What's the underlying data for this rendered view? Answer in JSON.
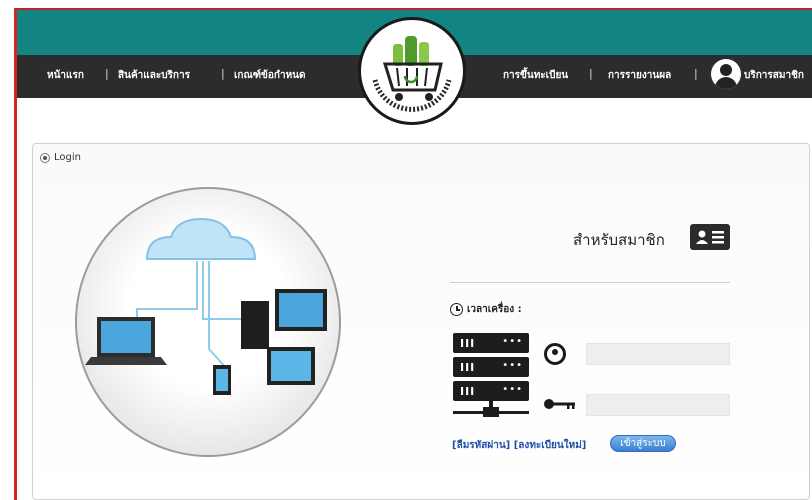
{
  "header": {
    "nav_left": [
      "หน้าแรก",
      "สินค้าและบริการ",
      "เกณฑ์ข้อกำหนด"
    ],
    "nav_right": [
      "การขึ้นทะเบียน",
      "การรายงานผล"
    ],
    "member_service": "บริการสมาชิก",
    "separator": "|",
    "colors": {
      "top_bar": "#128481",
      "nav_bar": "#2c2c2c"
    }
  },
  "logo": {
    "icon": "green-shopping-cart-logo"
  },
  "content": {
    "tab_label": "Login",
    "member_title": "สำหรับสมาชิก",
    "clock_label": "เวลาเครื่อง :",
    "username": {
      "value": "",
      "placeholder": ""
    },
    "password": {
      "value": "",
      "placeholder": ""
    },
    "forgot_link": "[ลืมรหัสผ่าน]",
    "register_link": "[ลงทะเบียนใหม่]",
    "login_button": "เข้าสู่ระบบ",
    "illustration": "cloud-network-devices-illustration"
  }
}
